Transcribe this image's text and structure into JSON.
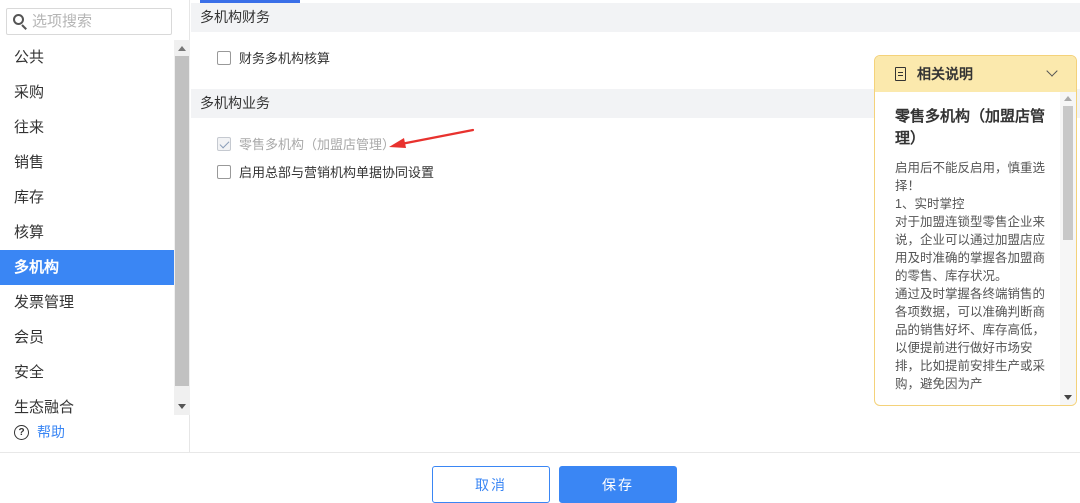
{
  "search": {
    "placeholder": "选项搜索"
  },
  "sidebar": {
    "items": [
      {
        "label": "公共"
      },
      {
        "label": "采购"
      },
      {
        "label": "往来"
      },
      {
        "label": "销售"
      },
      {
        "label": "库存"
      },
      {
        "label": "核算"
      },
      {
        "label": "多机构",
        "active": true
      },
      {
        "label": "发票管理"
      },
      {
        "label": "会员"
      },
      {
        "label": "安全"
      },
      {
        "label": "生态融合"
      }
    ],
    "help_label": "帮助"
  },
  "main": {
    "sections": [
      {
        "title": "多机构财务",
        "options": [
          {
            "label": "财务多机构核算",
            "checked": false,
            "disabled": false
          }
        ]
      },
      {
        "title": "多机构业务",
        "options": [
          {
            "label": "零售多机构（加盟店管理）",
            "checked": true,
            "disabled": true
          },
          {
            "label": "启用总部与营销机构单据协同设置",
            "checked": false,
            "disabled": false
          }
        ]
      }
    ]
  },
  "info_panel": {
    "title": "相关说明",
    "heading": "零售多机构（加盟店管理）",
    "paragraphs": [
      "启用后不能反启用，慎重选择！",
      "1、实时掌控",
      "对于加盟连锁型零售企业来说，企业可以通过加盟店应用及时准确的掌握各加盟商的零售、库存状况。",
      "通过及时掌握各终端销售的各项数据，可以准确判断商品的销售好坏、库存高低，以便提前进行做好市场安排，比如提前安排生产或采购，避免因为产"
    ]
  },
  "footer": {
    "cancel_label": "取消",
    "save_label": "保存"
  },
  "colors": {
    "accent": "#3a86f4",
    "panel_header": "#fbe9ad",
    "panel_border": "#f4d27a",
    "annotation_arrow": "#e8322e"
  }
}
